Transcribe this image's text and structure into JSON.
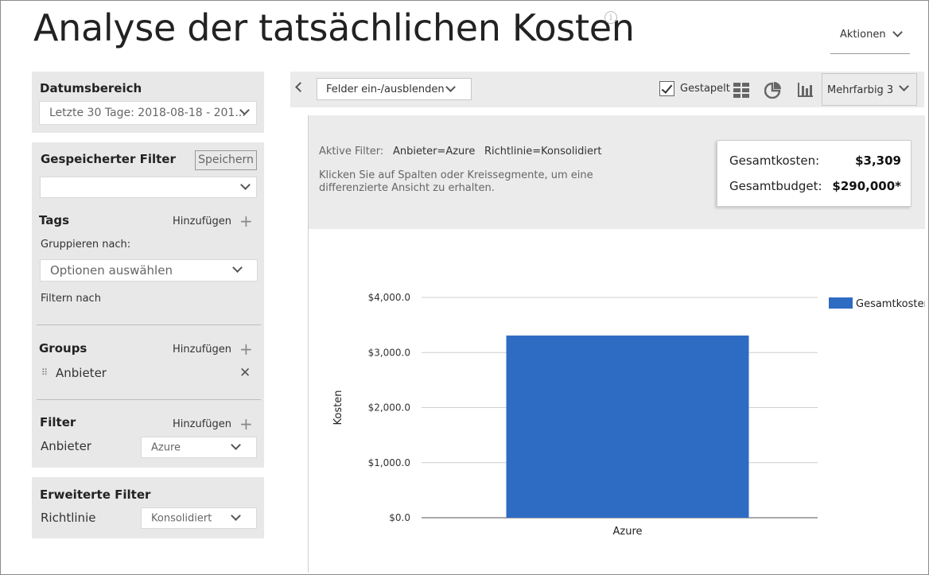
{
  "header": {
    "title": "Analyse der tatsächlichen Kosten",
    "info_icon": "info-icon",
    "actions_label": "Aktionen"
  },
  "sidebar": {
    "date_range": {
      "title": "Datumsbereich",
      "value": "Letzte 30 Tage: 2018-08-18 - 201..."
    },
    "saved_filter": {
      "title": "Gespeicherter Filter",
      "save_label": "Speichern",
      "value": ""
    },
    "tags": {
      "title": "Tags",
      "add_label": "Hinzufügen",
      "group_by_label": "Gruppieren nach:",
      "group_by_placeholder": "Optionen auswählen",
      "filter_by_label": "Filtern nach"
    },
    "groups": {
      "title": "Groups",
      "add_label": "Hinzufügen",
      "items": [
        "Anbieter"
      ]
    },
    "filter": {
      "title": "Filter",
      "add_label": "Hinzufügen",
      "field_label": "Anbieter",
      "value": "Azure"
    },
    "advanced_filter": {
      "title": "Erweiterte Filter",
      "field_label": "Richtlinie",
      "value": "Konsolidiert"
    }
  },
  "toolbar": {
    "fields_label": "Felder ein-/ausblenden",
    "stacked_label": "Gestapelt",
    "stacked_checked": true,
    "palette_label": "Mehrfarbig 3"
  },
  "filters": {
    "active_label": "Aktive Filter:",
    "active_values": [
      "Anbieter=Azure",
      "Richtlinie=Konsolidiert"
    ],
    "hint": "Klicken Sie auf Spalten oder Kreissegmente, um eine differenzierte Ansicht zu erhalten."
  },
  "totals": {
    "cost_label": "Gesamtkosten:",
    "cost_value": "$3,309",
    "budget_label": "Gesamtbudget:",
    "budget_value": "$290,000*"
  },
  "chart_data": {
    "type": "bar",
    "categories": [
      "Azure"
    ],
    "series": [
      {
        "name": "Gesamtkosten",
        "values": [
          3309
        ],
        "color": "#2e6cc4"
      }
    ],
    "ylabel": "Kosten",
    "ylim": [
      0,
      4000
    ],
    "yticks": [
      0,
      1000,
      2000,
      3000,
      4000
    ],
    "ytick_labels": [
      "$0.0",
      "$1,000.0",
      "$2,000.0",
      "$3,000.0",
      "$4,000.0"
    ],
    "grid": true,
    "legend": "right"
  }
}
